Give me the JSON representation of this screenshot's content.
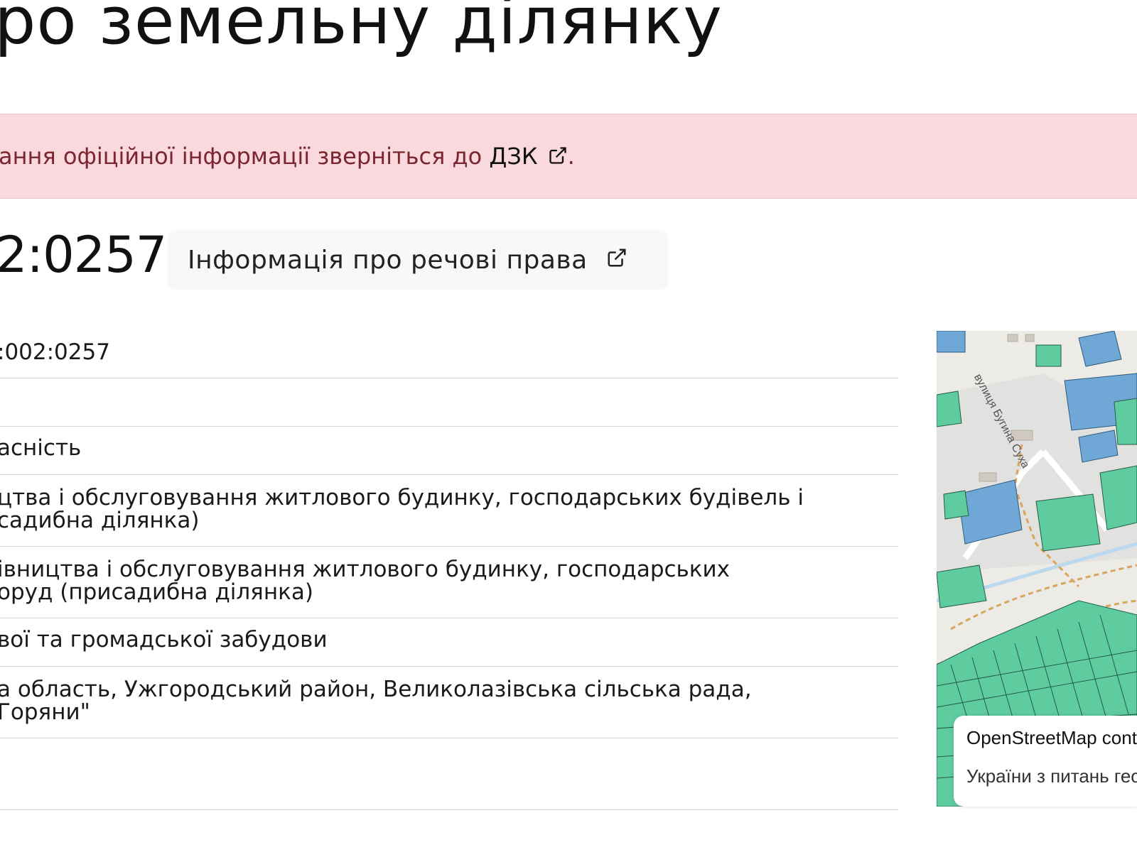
{
  "header": {
    "title": "ро земельну ділянку"
  },
  "alert": {
    "text_before": "ання офіційної інформації зверніться до ",
    "link_label": "ДЗК",
    "text_after": "."
  },
  "parcel": {
    "cadastral_number_fragment": "2:0257",
    "rights_button_label": "Інформація про речові права"
  },
  "details": {
    "rows": [
      {
        "lines": [
          ":002:0257"
        ]
      },
      {
        "lines": []
      },
      {
        "lines": [
          "асність"
        ]
      },
      {
        "lines": [
          "цтва і обслуговування житлового будинку, господарських будівель і",
          "садибна ділянка)"
        ]
      },
      {
        "lines": [
          "івництва і обслуговування житлового будинку, господарських",
          "оруд (присадибна ділянка)"
        ]
      },
      {
        "lines": [
          "вої та громадської забудови"
        ]
      },
      {
        "lines": [
          "а область, Ужгородський район, Великолазівська сільська рада,",
          "Горяни\""
        ]
      },
      {
        "lines": []
      }
    ]
  },
  "map": {
    "street_label": "вулиця Бугина Суха",
    "attribution_line1": "OpenStreetMap cont",
    "attribution_line2": "України з питань гео"
  },
  "icons": {
    "external_link": "external-link-icon"
  },
  "colors": {
    "alert_bg": "#f9d9dd",
    "alert_text": "#7a2530",
    "parcel_green": "#5fcca0",
    "parcel_blue": "#6fa8d6"
  }
}
